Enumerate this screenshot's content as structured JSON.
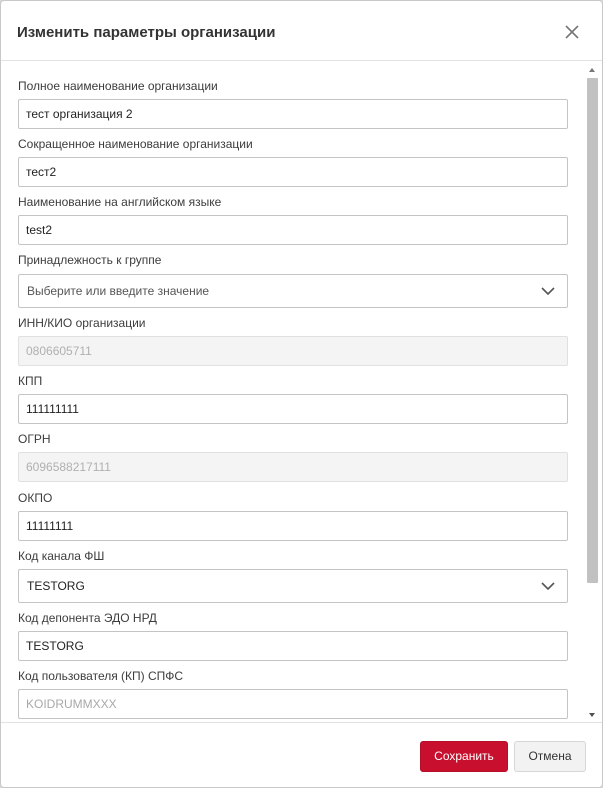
{
  "dialog": {
    "title": "Изменить параметры организации",
    "close_icon": "close-icon"
  },
  "fields": {
    "full_name": {
      "label": "Полное наименование организации",
      "value": "тест организация 2"
    },
    "short_name": {
      "label": "Сокращенное наименование организации",
      "value": "тест2"
    },
    "english_name": {
      "label": "Наименование на английском языке",
      "value": "test2"
    },
    "group": {
      "label": "Принадлежность к группе",
      "placeholder": "Выберите или введите значение"
    },
    "inn": {
      "label": "ИНН/КИО организации",
      "value": "0806605711"
    },
    "kpp": {
      "label": "КПП",
      "value": "111111111"
    },
    "ogrn": {
      "label": "ОГРН",
      "value": "6096588217111"
    },
    "okpo": {
      "label": "ОКПО",
      "value": "11111111"
    },
    "fsh_channel": {
      "label": "Код канала ФШ",
      "value": "TESTORG"
    },
    "edo_depositor": {
      "label": "Код депонента ЭДО НРД",
      "value": "TESTORG"
    },
    "spfs_user": {
      "label": "Код пользователя (КП) СПФС",
      "placeholder": "KOIDRUMMXXX"
    }
  },
  "footer": {
    "save_label": "Сохранить",
    "cancel_label": "Отмена"
  },
  "colors": {
    "primary": "#c8102e",
    "disabled_bg": "#f4f4f4"
  }
}
